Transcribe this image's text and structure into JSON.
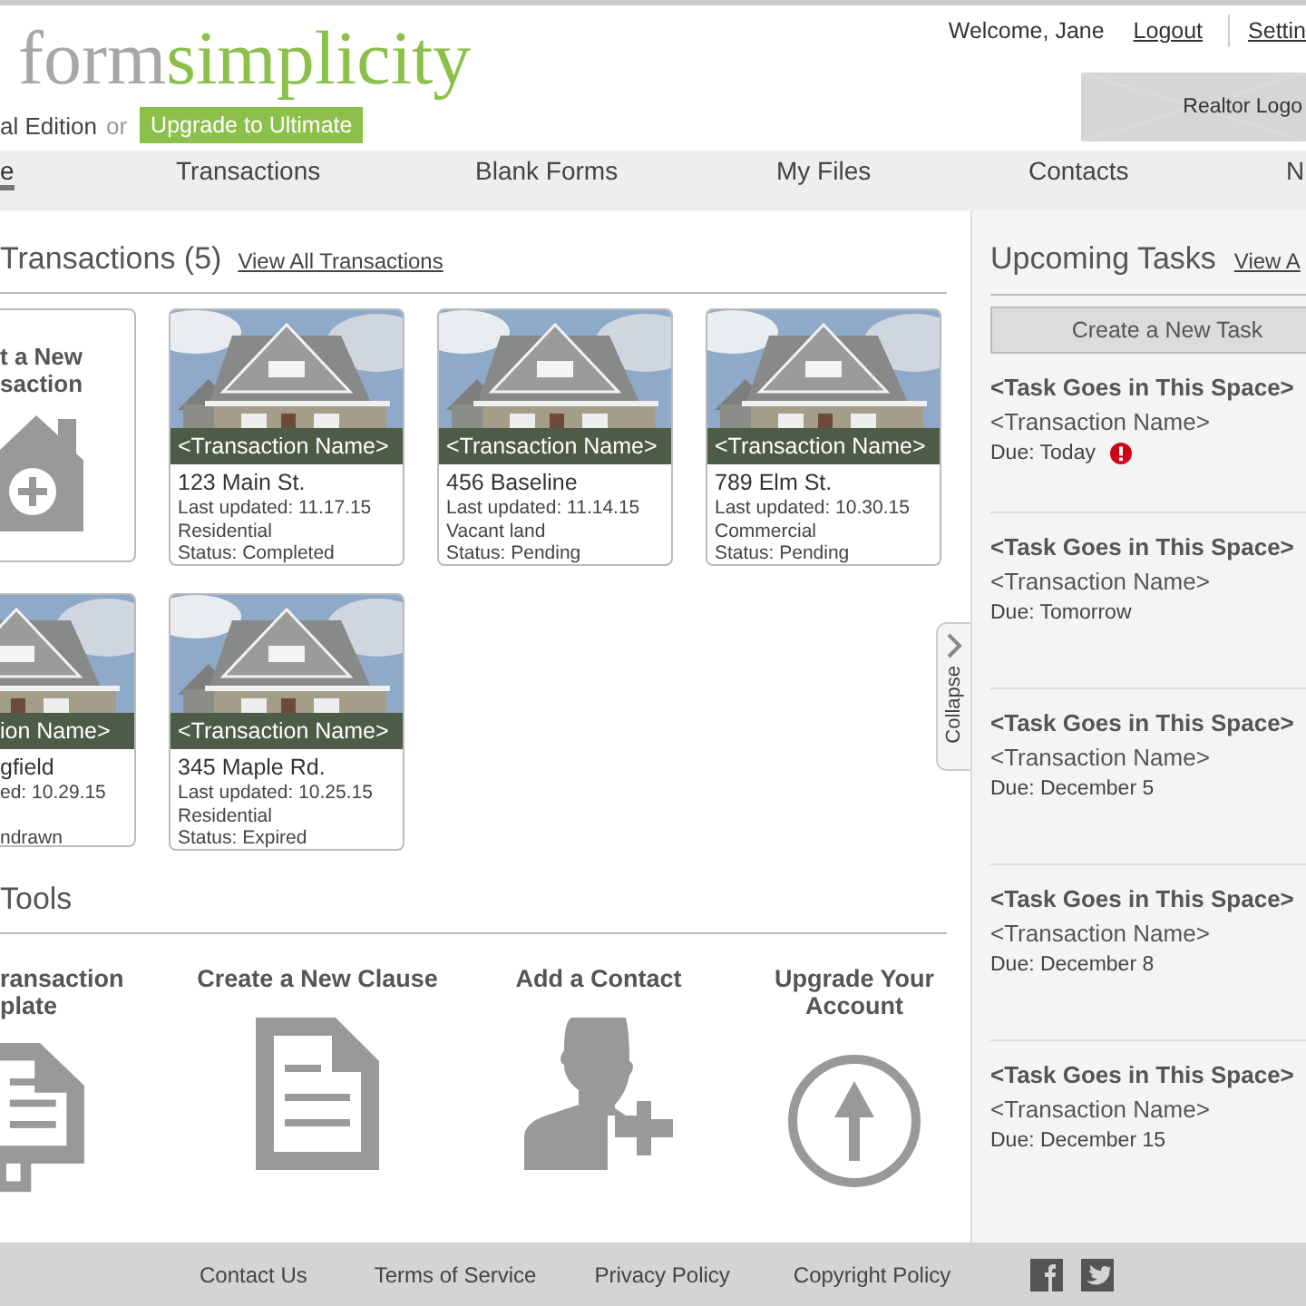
{
  "header": {
    "logo": {
      "part1": "form",
      "part2": "simplicity"
    },
    "edition": "al Edition",
    "or": "or",
    "upgrade_button": "Upgrade to Ultimate",
    "welcome": "Welcome, Jane",
    "logout": "Logout",
    "settings": "Settin",
    "realtor_logo": "Realtor Logo"
  },
  "nav": [
    {
      "label": "e",
      "selected": true
    },
    {
      "label": "Transactions",
      "selected": false
    },
    {
      "label": "Blank Forms",
      "selected": false
    },
    {
      "label": "My Files",
      "selected": false
    },
    {
      "label": "Contacts",
      "selected": false
    },
    {
      "label": "N",
      "selected": false
    }
  ],
  "transactions": {
    "title": "Transactions (5)",
    "link": "View All Transactions",
    "new_card": {
      "lines": [
        "t a New",
        "saction"
      ]
    },
    "cards": [
      {
        "name": "<Transaction Name>",
        "address": "123 Main St.",
        "updated": "Last updated: 11.17.15",
        "type": "Residential",
        "status": "Status: Completed"
      },
      {
        "name": "<Transaction Name>",
        "address": "456 Baseline",
        "updated": "Last updated: 11.14.15",
        "type": "Vacant land",
        "status": "Status: Pending"
      },
      {
        "name": "<Transaction Name>",
        "address": "789 Elm St.",
        "updated": "Last updated: 10.30.15",
        "type": "Commercial",
        "status": "Status: Pending"
      },
      {
        "name": "ion Name>",
        "address": "gfield",
        "updated": "ed: 10.29.15",
        "status": "ndrawn"
      },
      {
        "name": "<Transaction Name>",
        "address": "345 Maple Rd.",
        "updated": "Last updated: 10.25.15",
        "type": "Residential",
        "status": "Status: Expired"
      }
    ]
  },
  "tools": {
    "title": "Tools",
    "items": [
      {
        "kind": "template",
        "lines": [
          "ransaction",
          "plate"
        ]
      },
      {
        "kind": "clause",
        "lines": [
          "Create a New Clause"
        ]
      },
      {
        "kind": "contact",
        "lines": [
          "Add a Contact"
        ]
      },
      {
        "kind": "upgrade",
        "lines": [
          "Upgrade Your",
          "Account"
        ]
      }
    ]
  },
  "tasks": {
    "title": "Upcoming Tasks",
    "link": "View A",
    "create_button": "Create a New Task",
    "collapse": "Collapse",
    "items": [
      {
        "title": "<Task Goes in This Space>",
        "transaction": "<Transaction Name>",
        "due": "Due: Today",
        "alert": true
      },
      {
        "title": "<Task Goes in This Space>",
        "transaction": "<Transaction Name>",
        "due": "Due: Tomorrow",
        "alert": false
      },
      {
        "title": "<Task Goes in This Space>",
        "transaction": "<Transaction Name>",
        "due": "Due: December 5",
        "alert": false
      },
      {
        "title": "<Task Goes in This Space>",
        "transaction": "<Transaction Name>",
        "due": "Due: December 8",
        "alert": false
      },
      {
        "title": "<Task Goes in This Space>",
        "transaction": "<Transaction Name>",
        "due": "Due: December 15",
        "alert": false
      }
    ]
  },
  "footer": {
    "links": [
      "Contact Us",
      "Terms of Service",
      "Privacy Policy",
      "Copyright Policy"
    ]
  }
}
